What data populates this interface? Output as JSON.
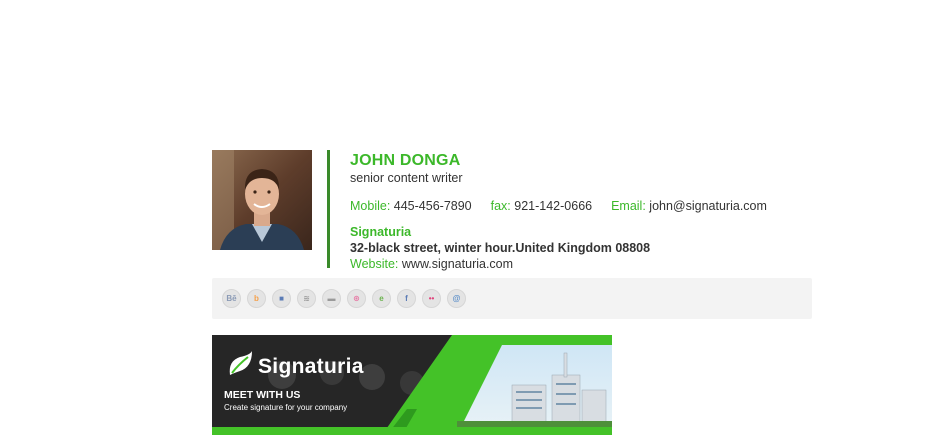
{
  "person": {
    "name": "JOHN DONGA",
    "title": "senior content writer"
  },
  "contact": {
    "mobile_label": "Mobile:",
    "mobile_value": "445-456-7890",
    "fax_label": "fax:",
    "fax_value": "921-142-0666",
    "email_label": "Email:",
    "email_value": "john@signaturia.com"
  },
  "company": {
    "name": "Signaturia",
    "address": "32-black street, winter hour.United Kingdom 08808",
    "website_label": "Website:",
    "website_value": "www.signaturia.com"
  },
  "social": {
    "icons": [
      "behance-icon",
      "blogger-icon",
      "delicious-icon",
      "digg-icon",
      "myspace-icon",
      "dribbble-icon",
      "evernote-icon",
      "facebook-icon",
      "flickr-icon",
      "skype-icon"
    ],
    "glyphs": [
      "Bē",
      "b",
      "■",
      "≋",
      "▬",
      "⊛",
      "e",
      "f",
      "••",
      "@"
    ]
  },
  "banner": {
    "brand": "Signaturia",
    "headline": "MEET WITH US",
    "subtext": "Create signature for your company"
  },
  "colors": {
    "accent": "#3cb82a",
    "divider": "#3a8a2a",
    "text": "#333333",
    "social_bar": "#f3f3f3",
    "banner_dark": "#262626",
    "banner_green": "#44c228"
  }
}
